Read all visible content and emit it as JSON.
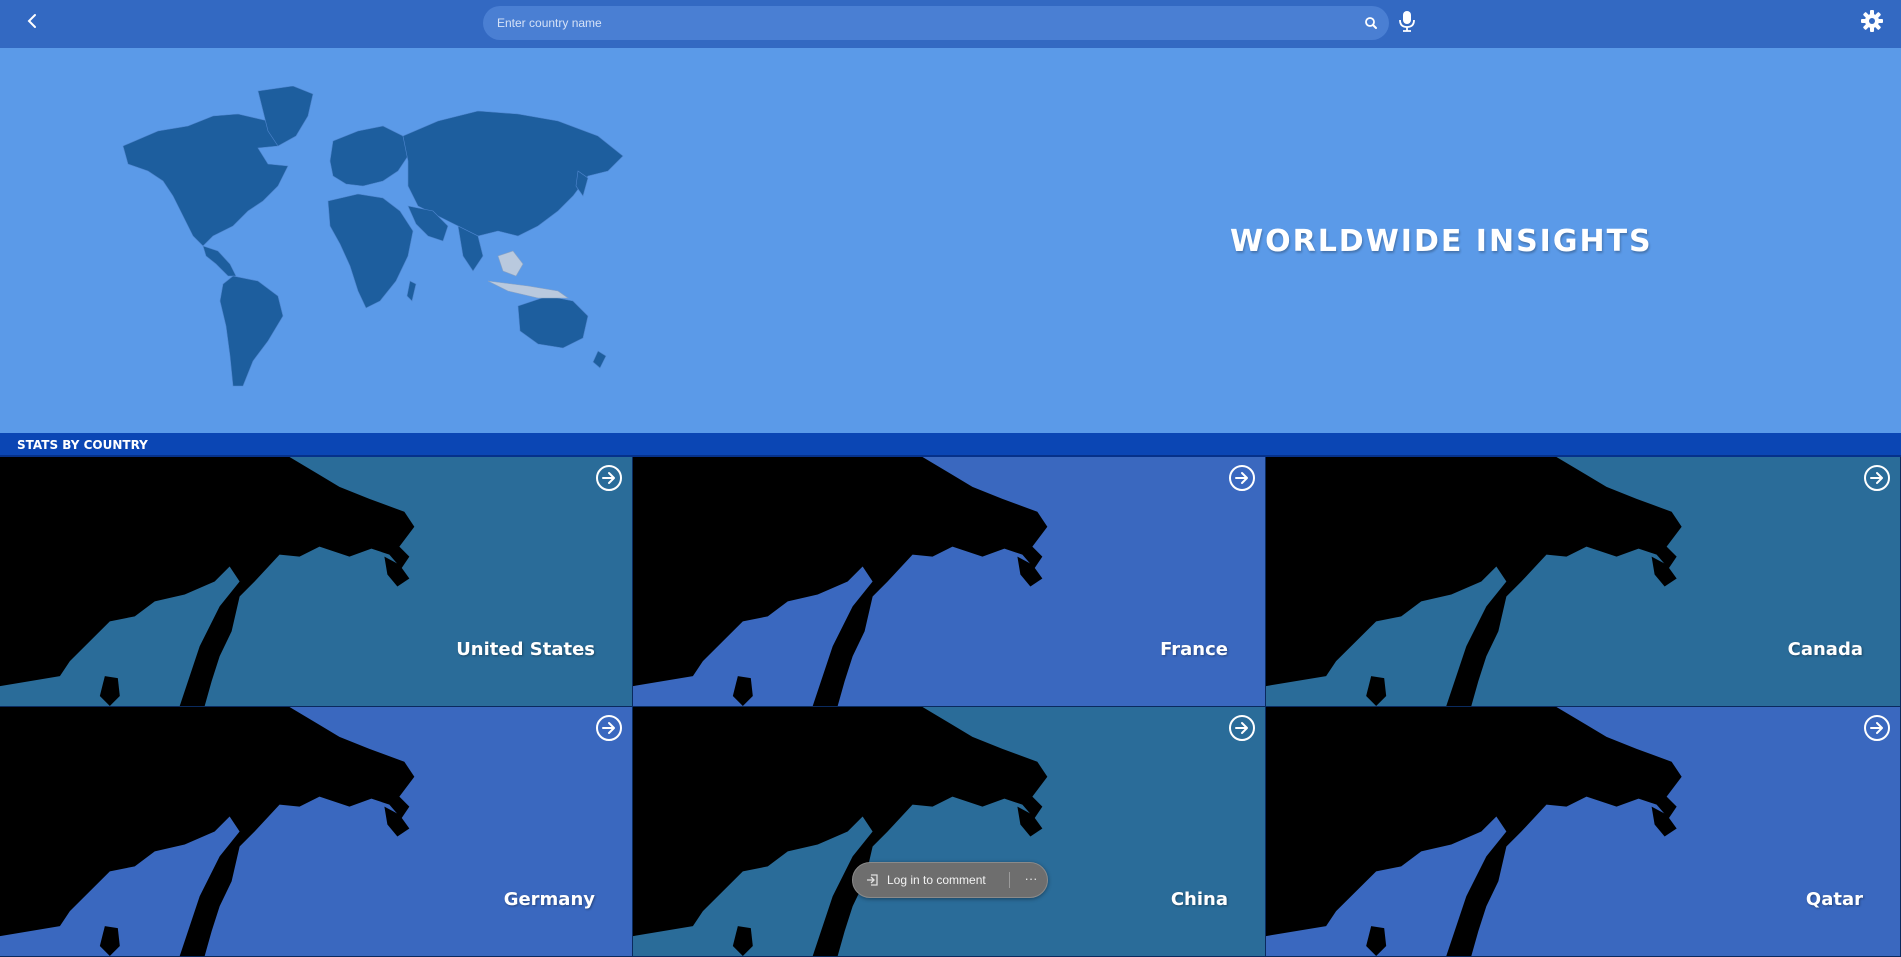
{
  "header": {
    "back_icon": "chevron-left-icon",
    "search": {
      "placeholder": "Enter country name",
      "value": ""
    },
    "search_icon": "search-icon",
    "mic_icon": "microphone-icon",
    "settings_icon": "gear-icon"
  },
  "hero": {
    "title": "WORLDWIDE INSIGHTS",
    "map_icon": "world-map"
  },
  "section": {
    "title": "STATS BY COUNTRY"
  },
  "countries": [
    {
      "name": "United States",
      "color": "#2a6c99"
    },
    {
      "name": "France",
      "color": "#3a68bf"
    },
    {
      "name": "Canada",
      "color": "#2a6c99"
    },
    {
      "name": "Germany",
      "color": "#3a68bf"
    },
    {
      "name": "China",
      "color": "#2a6c99"
    },
    {
      "name": "Qatar",
      "color": "#3a68bf"
    }
  ],
  "comment": {
    "login_label": "Log in to comment",
    "more_label": "···"
  },
  "colors": {
    "topbar": "#3369c2",
    "hero": "#5b9ae8",
    "section_bar": "#0b46b4",
    "map_land": "#1d5e9e"
  }
}
